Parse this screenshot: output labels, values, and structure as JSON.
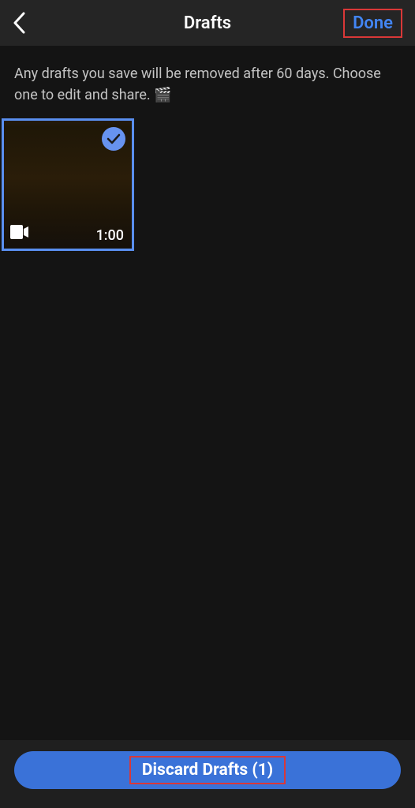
{
  "header": {
    "title": "Drafts",
    "done_label": "Done"
  },
  "info": {
    "text": "Any drafts you save will be removed after 60 days. Choose one to edit and share. 🎬"
  },
  "drafts": [
    {
      "duration": "1:00",
      "selected": true
    }
  ],
  "footer": {
    "discard_label": "Discard Drafts (1)"
  }
}
